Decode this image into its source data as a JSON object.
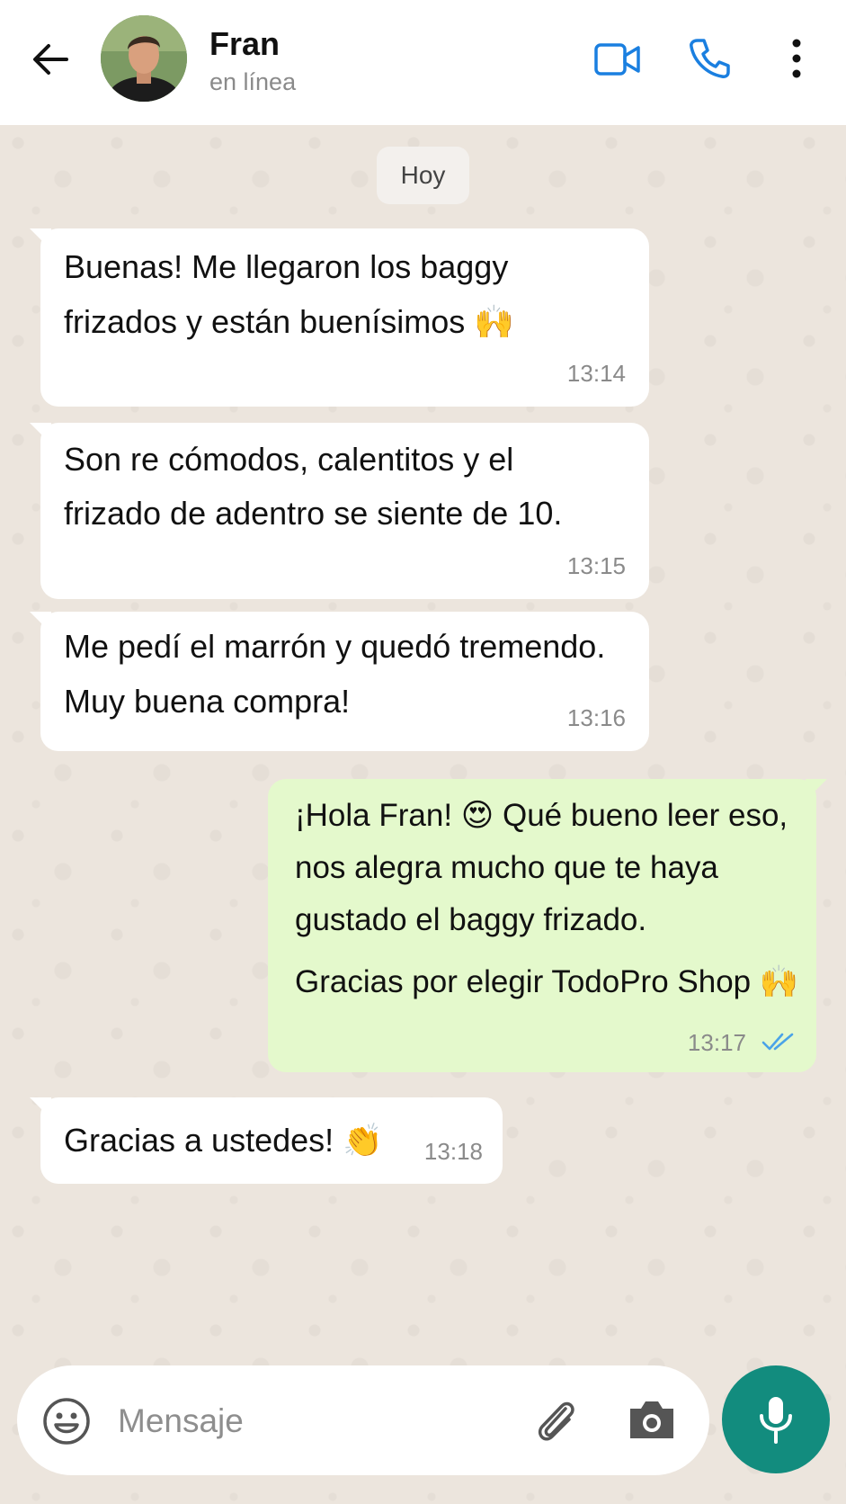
{
  "header": {
    "contact_name": "Fran",
    "status": "en línea"
  },
  "date_chip": "Hoy",
  "messages": [
    {
      "direction": "incoming",
      "lines": [
        "Buenas! Me llegaron los baggy",
        "frizados y están buenísimos 🙌"
      ],
      "time": "13:14"
    },
    {
      "direction": "incoming",
      "lines": [
        "Son re cómodos, calentitos y el",
        "frizado de adentro se siente de 10."
      ],
      "time": "13:15"
    },
    {
      "direction": "incoming",
      "lines": [
        "Me pedí el marrón y quedó tremendo.",
        "Muy buena compra!"
      ],
      "time": "13:16"
    },
    {
      "direction": "outgoing",
      "lines": [
        "¡Hola Fran! 😍 Qué bueno leer eso,",
        "nos alegra mucho que te haya",
        "gustado el baggy frizado.",
        "Gracias por elegir TodoPro Shop 🙌"
      ],
      "time": "13:17",
      "status": "read"
    },
    {
      "direction": "incoming",
      "lines": [
        "Gracias a ustedes! 👏"
      ],
      "time": "13:18"
    }
  ],
  "composer": {
    "placeholder": "Mensaje",
    "value": ""
  },
  "colors": {
    "accent": "#1a7fe0",
    "chat_bg": "#ece5dd",
    "outgoing_bubble": "#e4f9cc",
    "incoming_bubble": "#ffffff",
    "mic_button": "#128c7e",
    "read_ticks": "#4aa3e8"
  },
  "icons": [
    "back-arrow-icon",
    "video-call-icon",
    "phone-icon",
    "more-vert-icon",
    "emoji-icon",
    "attach-icon",
    "camera-icon",
    "mic-icon",
    "double-check-icon"
  ]
}
